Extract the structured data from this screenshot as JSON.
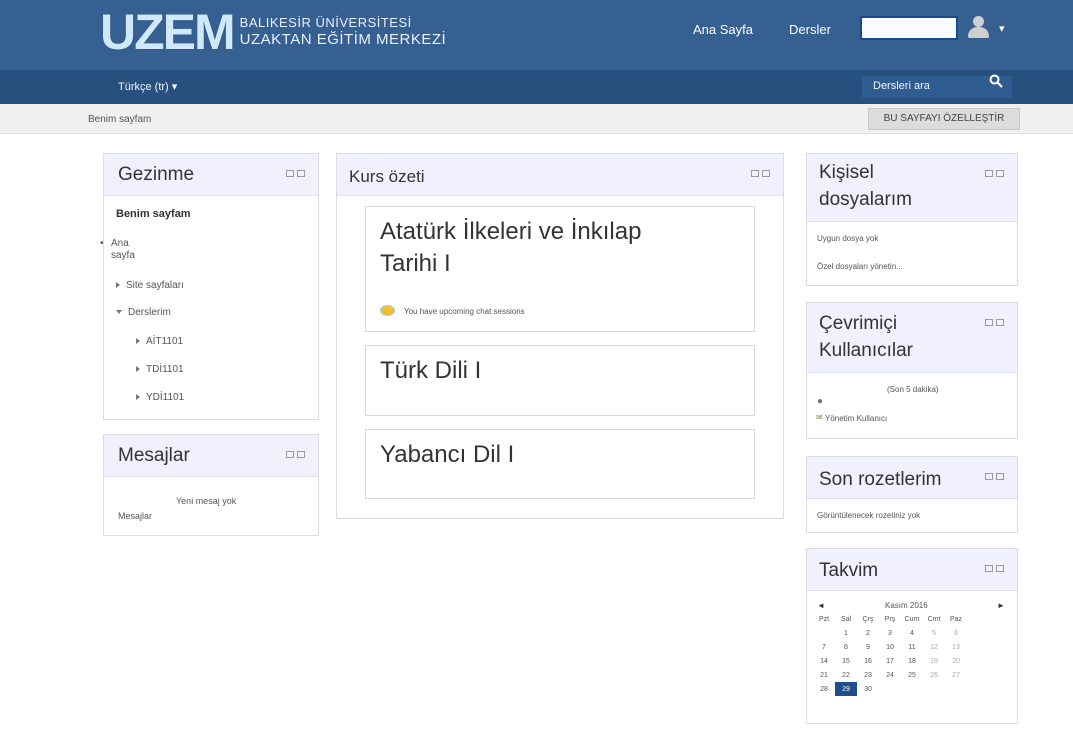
{
  "header": {
    "logo_mark": "UZEM",
    "logo_line1": "BALIKESİR ÜNİVERSİTESİ",
    "logo_line2": "UZAKTAN EĞİTİM MERKEZİ",
    "nav_home": "Ana Sayfa",
    "nav_courses": "Dersler",
    "user_menu_caret": "▾",
    "login_value": ""
  },
  "subbar": {
    "language": "Türkçe (tr) ▾",
    "search_placeholder": "Dersleri ara",
    "search_icon": "search-icon"
  },
  "breadcrumb": {
    "item": "Benim sayfam",
    "customize_button": "BU SAYFAYI ÖZELLEŞTİR"
  },
  "navigation_block": {
    "title": "Gezinme",
    "my_page": "Benim sayfam",
    "home_line1": "Ana",
    "home_line2": "sayfa",
    "site_pages": "Site sayfaları",
    "my_courses": "Derslerim",
    "courses": [
      "AİT1101",
      "TDİ1101",
      "YDİ1101"
    ]
  },
  "messages_block": {
    "title": "Mesajlar",
    "no_messages": "Yeni mesaj yok",
    "link": "Mesajlar"
  },
  "course_overview": {
    "title": "Kurs özeti",
    "courses": [
      {
        "name_line1": "Atatürk İlkeleri ve İnkılap",
        "name_line2": "Tarihi I",
        "notice": "You have upcoming chat sessions"
      },
      {
        "name_line1": "Türk Dili I"
      },
      {
        "name_line1": "Yabancı Dil I"
      }
    ]
  },
  "private_files_block": {
    "title_line1": "Kişisel",
    "title_line2": "dosyalarım",
    "no_files": "Uygun dosya yok",
    "manage": "Özel dosyaları yönetin..."
  },
  "online_users_block": {
    "title_line1": "Çevrimiçi",
    "title_line2": "Kullanıcılar",
    "period": "(Son 5 dakika)",
    "user": "Yönetim Kullanıcı"
  },
  "badges_block": {
    "title": "Son rozetlerim",
    "empty": "Görüntülenecek rozetiniz yok"
  },
  "calendar_block": {
    "title": "Takvim",
    "prev": "◄",
    "next": "►",
    "month": "Kasım 2016",
    "weekdays": [
      "Pzt",
      "Sal",
      "Çrş",
      "Prş",
      "Cum",
      "Cmt",
      "Paz"
    ],
    "weeks": [
      [
        "",
        "1",
        "2",
        "3",
        "4",
        "5",
        "6"
      ],
      [
        "7",
        "8",
        "9",
        "10",
        "11",
        "12",
        "13"
      ],
      [
        "14",
        "15",
        "16",
        "17",
        "18",
        "19",
        "20"
      ],
      [
        "21",
        "22",
        "23",
        "24",
        "25",
        "26",
        "27"
      ],
      [
        "28",
        "29",
        "30",
        "",
        "",
        "",
        ""
      ]
    ],
    "today": "29",
    "colors": {
      "today_bg": "#1f4e8a",
      "header_bg": "#365f92"
    }
  }
}
